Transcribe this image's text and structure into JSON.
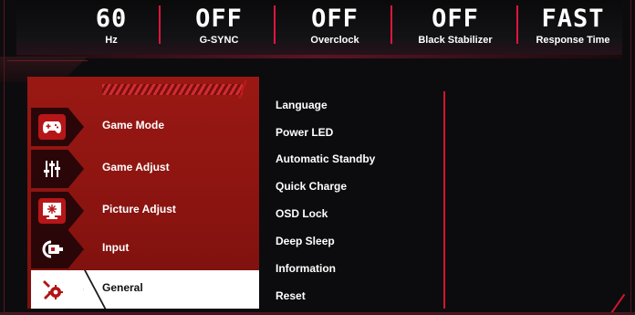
{
  "header": {
    "stats": [
      {
        "value": "60",
        "label": "Hz"
      },
      {
        "value": "OFF",
        "label": "G-SYNC"
      },
      {
        "value": "OFF",
        "label": "Overclock"
      },
      {
        "value": "OFF",
        "label": "Black Stabilizer"
      },
      {
        "value": "FAST",
        "label": "Response Time"
      }
    ]
  },
  "sidebar": {
    "items": [
      {
        "label": "Game Mode",
        "icon": "gamepad-icon",
        "active": false
      },
      {
        "label": "Game Adjust",
        "icon": "sliders-icon",
        "active": false
      },
      {
        "label": "Picture Adjust",
        "icon": "picture-icon",
        "active": false
      },
      {
        "label": "Input",
        "icon": "input-icon",
        "active": false
      },
      {
        "label": "General",
        "icon": "tools-gear-icon",
        "active": true
      }
    ]
  },
  "submenu": {
    "items": [
      "Language",
      "Power LED",
      "Automatic Standby",
      "Quick Charge",
      "OSD Lock",
      "Deep Sleep",
      "Information",
      "Reset"
    ]
  },
  "colors": {
    "accent": "#e0153c",
    "panel": "#8a1410",
    "background": "#0c0c0e"
  }
}
